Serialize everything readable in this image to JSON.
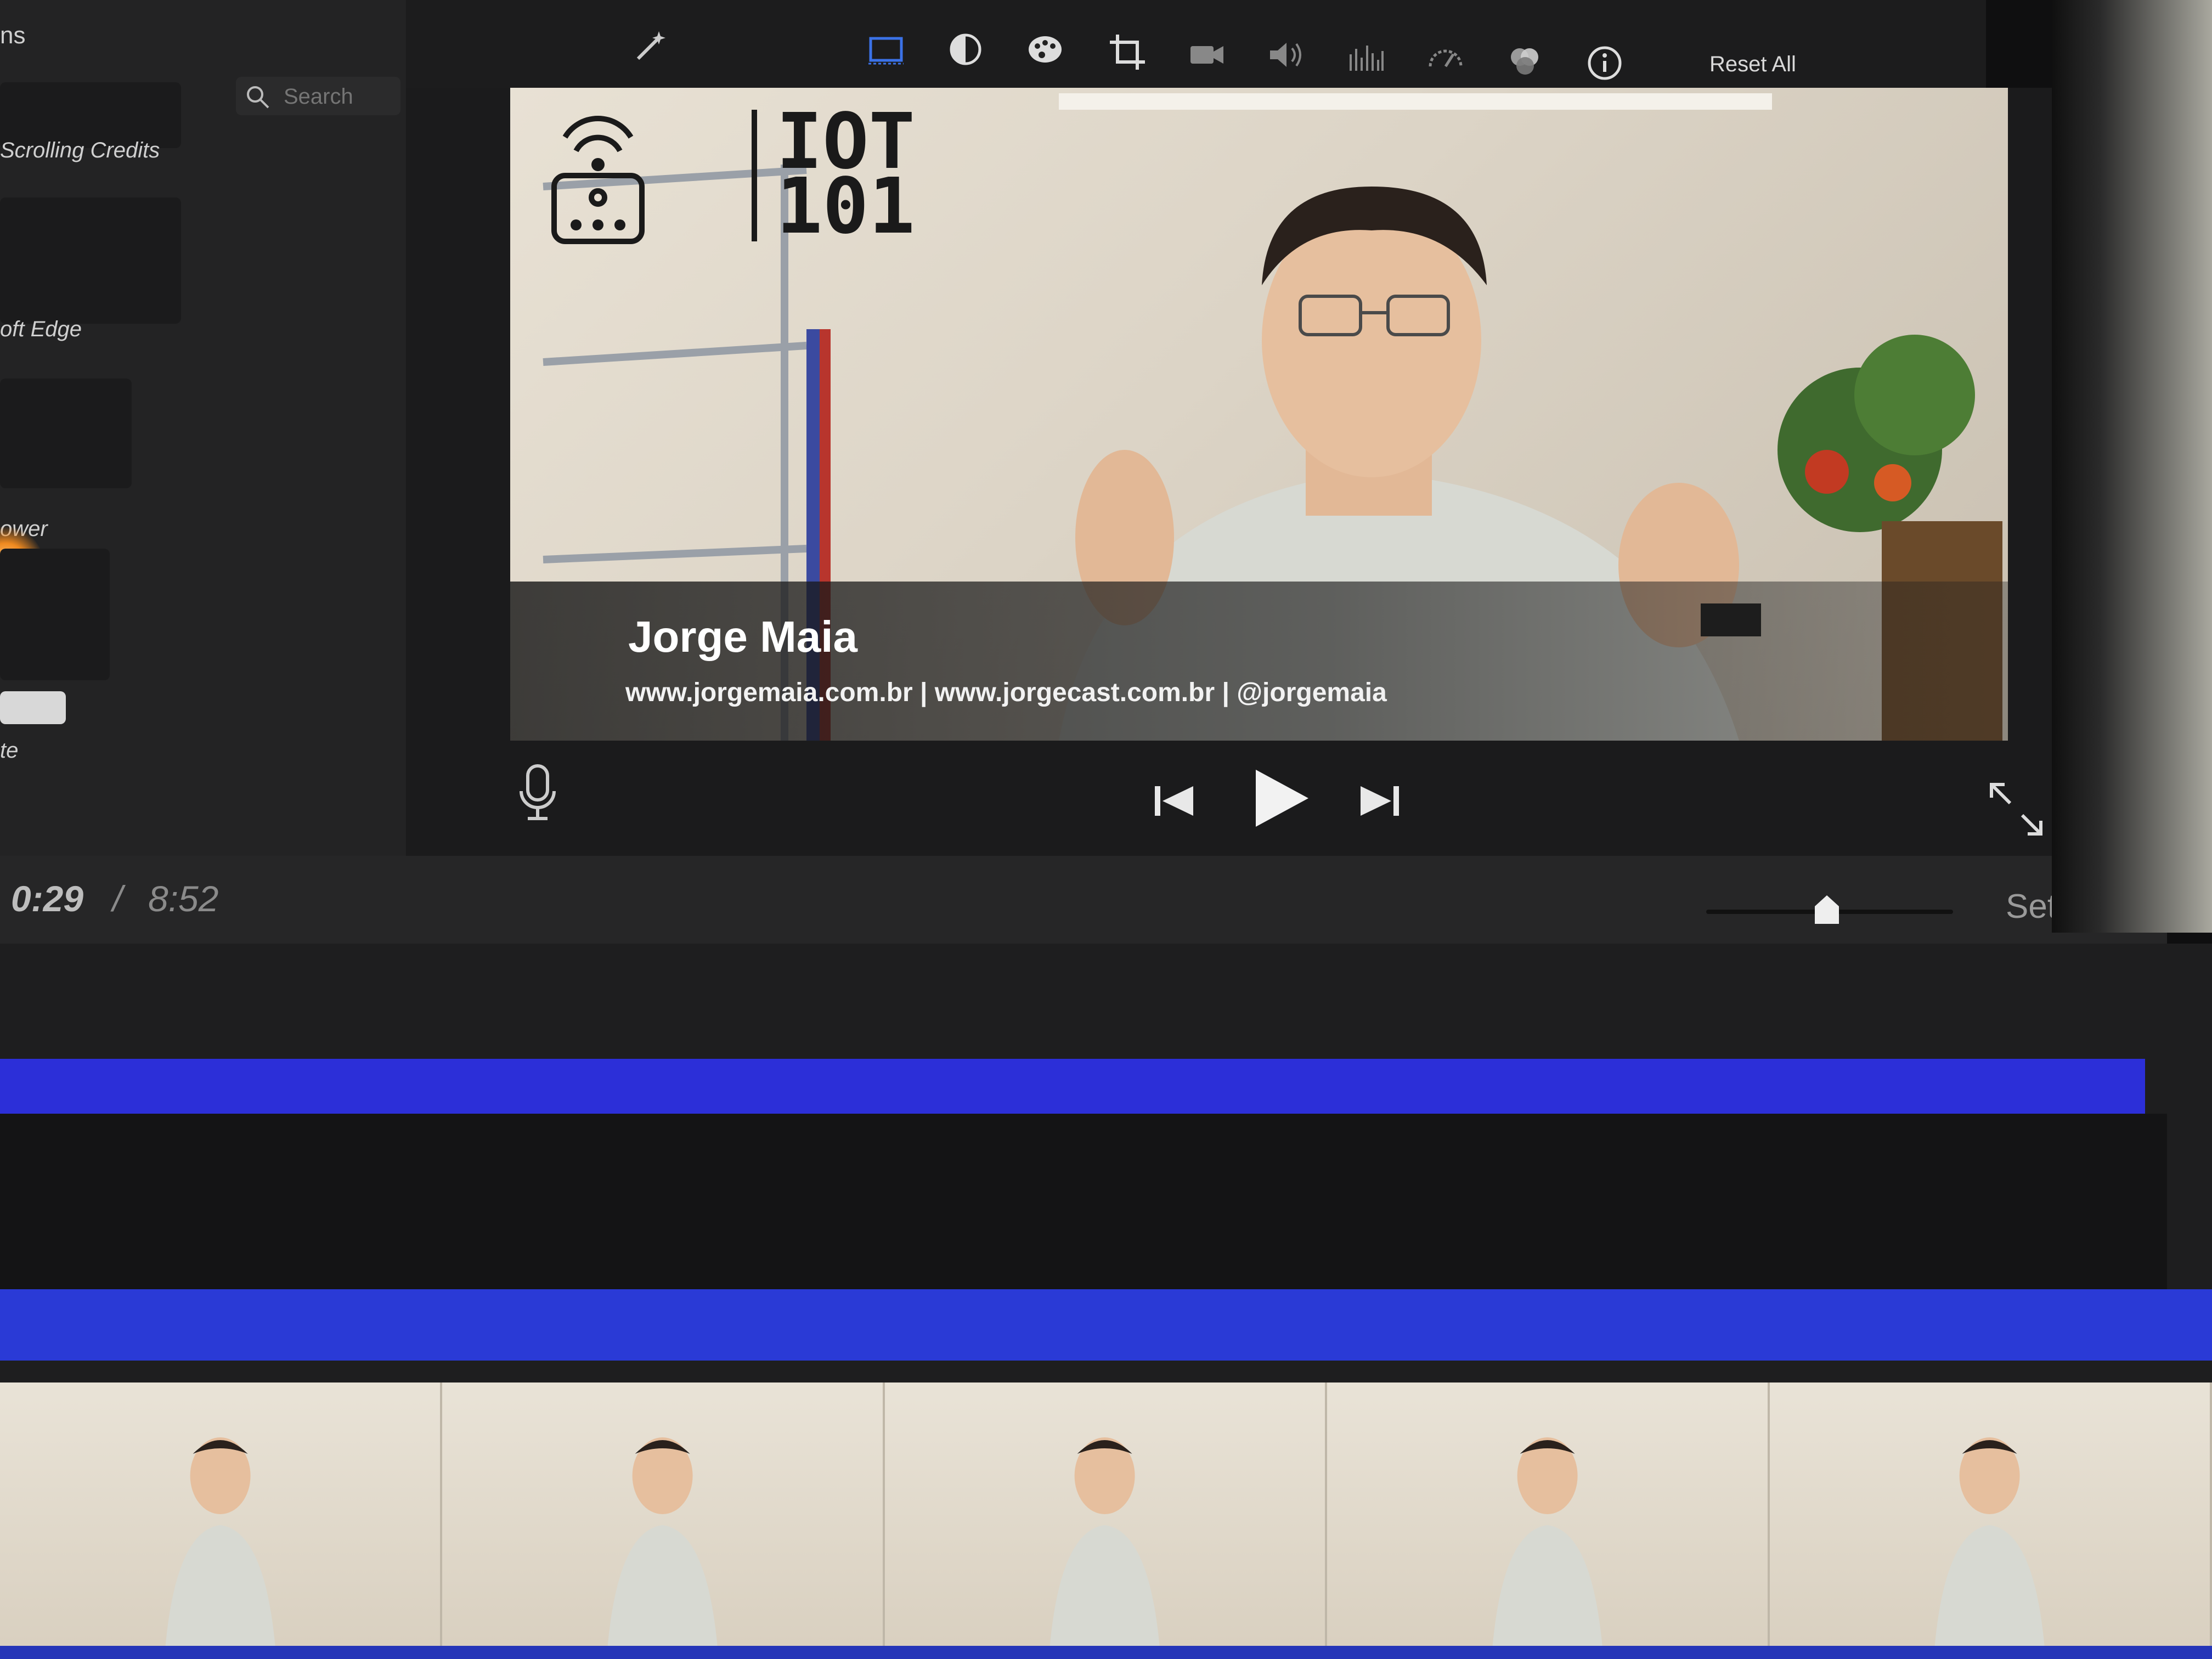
{
  "sidebar": {
    "title": "ns",
    "search": {
      "placeholder": "Search"
    },
    "items": [
      {
        "label": "Scrolling Credits"
      },
      {
        "label": "oft Edge"
      },
      {
        "label": "ower"
      },
      {
        "label": "te"
      }
    ]
  },
  "toolbar": {
    "tools": [
      {
        "icon": "magic-wand-icon"
      },
      {
        "icon": "crop-frame-icon"
      },
      {
        "icon": "color-balance-icon"
      },
      {
        "icon": "color-palette-icon"
      },
      {
        "icon": "crop-icon"
      },
      {
        "icon": "camera-stabilization-icon"
      },
      {
        "icon": "volume-icon"
      },
      {
        "icon": "equalizer-icon"
      },
      {
        "icon": "speed-icon"
      },
      {
        "icon": "clip-filter-icon"
      },
      {
        "icon": "info-icon"
      }
    ],
    "reset_label": "Reset All"
  },
  "viewer": {
    "logo": {
      "line1": "IOT",
      "line2": "101"
    },
    "lower_third": {
      "name": "Jorge Maia",
      "links": "www.jorgemaia.com.br | www.jorgecast.com.br | @jorgemaia"
    }
  },
  "playback": {
    "current_time": "0:29",
    "separator": "/",
    "total_time": "8:52"
  },
  "settings_label": "Settir",
  "colors": {
    "track_blue": "#2c2fd8",
    "background": "#1b1b1c"
  }
}
